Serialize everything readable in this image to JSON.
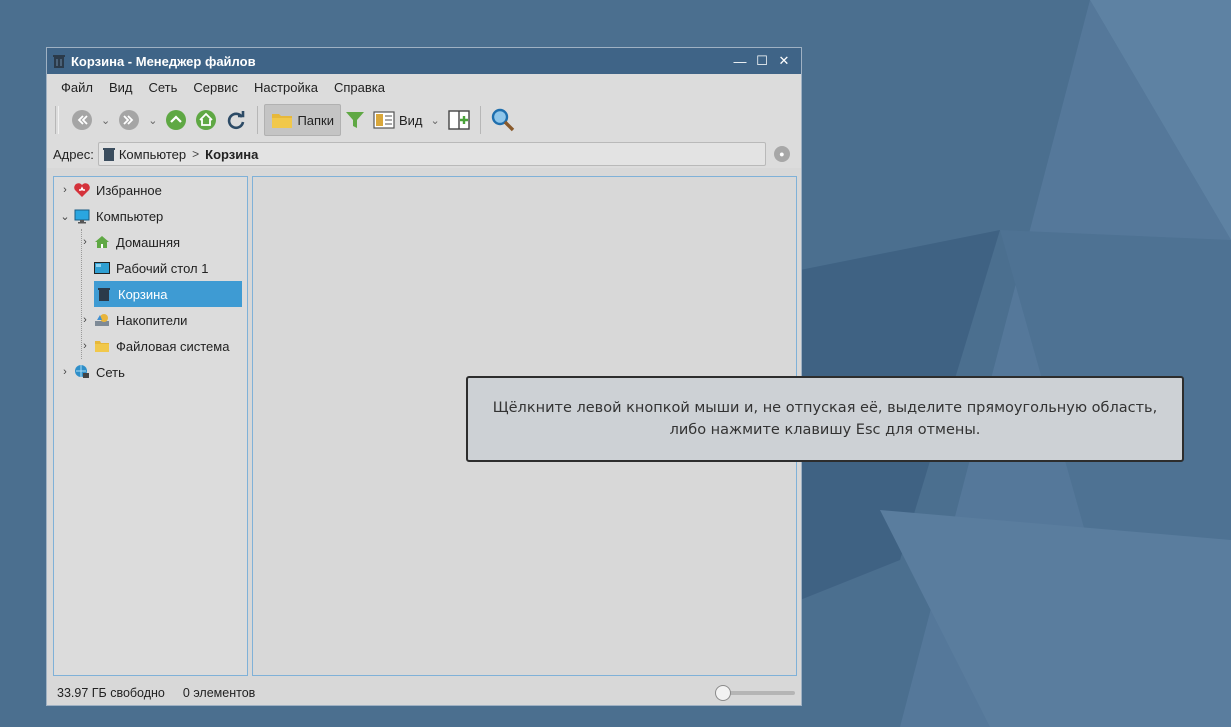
{
  "window": {
    "title": "Корзина - Менеджер файлов",
    "controls": {
      "minimize": "—",
      "maximize": "☐",
      "close": "✕"
    }
  },
  "menu": [
    "Файл",
    "Вид",
    "Сеть",
    "Сервис",
    "Настройка",
    "Справка"
  ],
  "toolbar": {
    "folders_label": "Папки",
    "view_label": "Вид",
    "icons": [
      "back-icon",
      "forward-icon",
      "up-icon",
      "home-icon",
      "reload-icon",
      "folder-icon",
      "filter-icon",
      "view-icon",
      "split-view-icon",
      "search-icon"
    ]
  },
  "address": {
    "label": "Адрес:",
    "crumbs": [
      "Компьютер",
      "Корзина"
    ]
  },
  "sidebar": {
    "items": [
      {
        "label": "Избранное",
        "icon": "favorites-heart-icon"
      },
      {
        "label": "Компьютер",
        "icon": "computer-icon"
      },
      {
        "label": "Домашняя",
        "icon": "home-icon"
      },
      {
        "label": "Рабочий стол 1",
        "icon": "desktop-icon"
      },
      {
        "label": "Корзина",
        "icon": "trash-icon"
      },
      {
        "label": "Накопители",
        "icon": "drives-icon"
      },
      {
        "label": "Файловая система",
        "icon": "folder-icon"
      },
      {
        "label": "Сеть",
        "icon": "network-icon"
      }
    ],
    "selected": "Корзина"
  },
  "status": {
    "free": "33.97 ГБ свободно",
    "count": "0 элементов"
  },
  "tooltip": {
    "line1": "Щёлкните левой кнопкой мыши и, не отпуская её, выделите прямоугольную область,",
    "line2": "либо нажмите клавишу Esc для отмены."
  },
  "colors": {
    "desktop": "#4b6f8f",
    "titlebar": "#3f6487",
    "selection": "#3e9bd3",
    "window_bg": "#d8d8d8"
  }
}
